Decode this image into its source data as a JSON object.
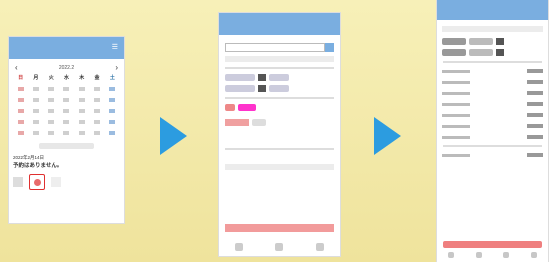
{
  "screens": [
    {
      "id": "calendar",
      "header_title": "",
      "month_label": "2022.2",
      "weekdays": [
        "日",
        "月",
        "火",
        "水",
        "木",
        "金",
        "土"
      ],
      "note_title": "予約はありません。",
      "note_meta": "2022年2月14日"
    },
    {
      "id": "search",
      "header_title": "",
      "search_placeholder": ""
    },
    {
      "id": "details",
      "header_title": ""
    }
  ],
  "colors": {
    "background": "#f4edae",
    "header": "#7aaee0",
    "arrow": "#2c9ce0",
    "accent_red": "#e03030"
  },
  "icons": [
    "chevron-left-icon",
    "chevron-right-icon",
    "plus-icon",
    "search-icon",
    "arrow-right-icon"
  ]
}
